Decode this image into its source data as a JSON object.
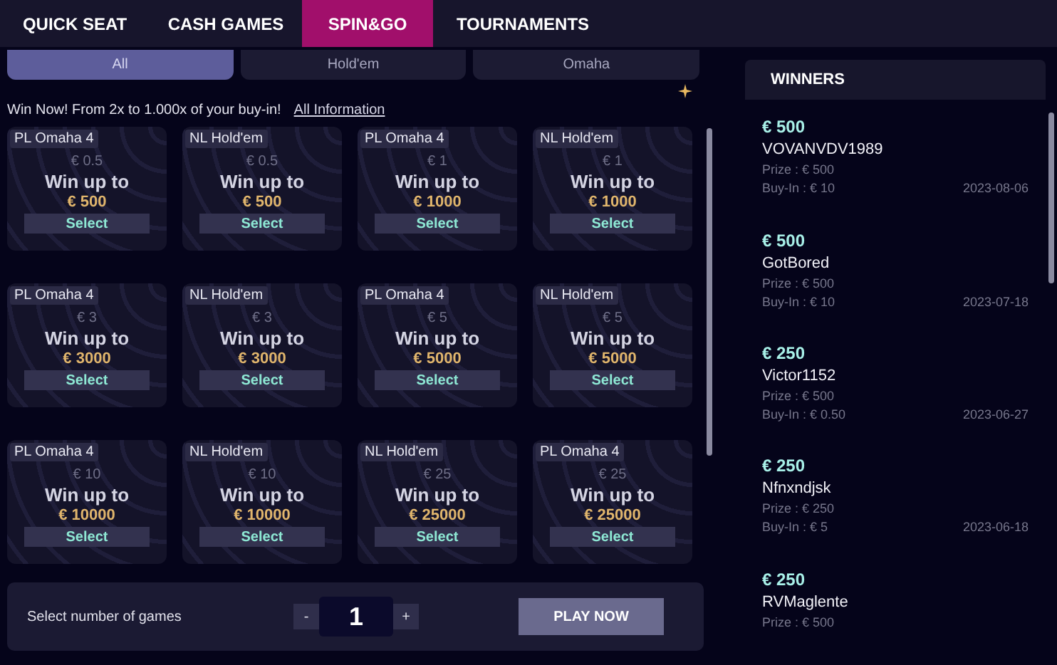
{
  "nav_tabs": [
    {
      "label": "QUICK SEAT",
      "selected": false
    },
    {
      "label": "CASH GAMES",
      "selected": false
    },
    {
      "label": "SPIN&GO",
      "selected": true
    },
    {
      "label": "TOURNAMENTS",
      "selected": false
    }
  ],
  "filters": [
    {
      "label": "All",
      "selected": true
    },
    {
      "label": "Hold'em",
      "selected": false
    },
    {
      "label": "Omaha",
      "selected": false
    }
  ],
  "info": {
    "text": "Win Now! From 2x to 1.000x of your buy-in!",
    "link": "All Information"
  },
  "games": [
    {
      "variant": "PL Omaha 4",
      "buy_in": "€ 0.5",
      "headline": "Win up to",
      "prize": "€ 500",
      "action": "Select"
    },
    {
      "variant": "NL Hold'em",
      "buy_in": "€ 0.5",
      "headline": "Win up to",
      "prize": "€ 500",
      "action": "Select"
    },
    {
      "variant": "PL Omaha 4",
      "buy_in": "€ 1",
      "headline": "Win up to",
      "prize": "€ 1000",
      "action": "Select"
    },
    {
      "variant": "NL Hold'em",
      "buy_in": "€ 1",
      "headline": "Win up to",
      "prize": "€ 1000",
      "action": "Select"
    },
    {
      "variant": "PL Omaha 4",
      "buy_in": "€ 3",
      "headline": "Win up to",
      "prize": "€ 3000",
      "action": "Select"
    },
    {
      "variant": "NL Hold'em",
      "buy_in": "€ 3",
      "headline": "Win up to",
      "prize": "€ 3000",
      "action": "Select"
    },
    {
      "variant": "PL Omaha 4",
      "buy_in": "€ 5",
      "headline": "Win up to",
      "prize": "€ 5000",
      "action": "Select"
    },
    {
      "variant": "NL Hold'em",
      "buy_in": "€ 5",
      "headline": "Win up to",
      "prize": "€ 5000",
      "action": "Select"
    },
    {
      "variant": "PL Omaha 4",
      "buy_in": "€ 10",
      "headline": "Win up to",
      "prize": "€ 10000",
      "action": "Select"
    },
    {
      "variant": "NL Hold'em",
      "buy_in": "€ 10",
      "headline": "Win up to",
      "prize": "€ 10000",
      "action": "Select"
    },
    {
      "variant": "NL Hold'em",
      "buy_in": "€ 25",
      "headline": "Win up to",
      "prize": "€ 25000",
      "action": "Select"
    },
    {
      "variant": "PL Omaha 4",
      "buy_in": "€ 25",
      "headline": "Win up to",
      "prize": "€ 25000",
      "action": "Select"
    }
  ],
  "game_count": {
    "label": "Select number of games",
    "minus": "-",
    "value": "1",
    "plus": "+",
    "play": "PLAY NOW"
  },
  "winners": {
    "title": "WINNERS",
    "items": [
      {
        "amount": "€ 500",
        "name": "VOVANVDV1989",
        "prize": "Prize : € 500",
        "buy_in": "Buy-In : € 10",
        "date": "2023-08-06"
      },
      {
        "amount": "€ 500",
        "name": "GotBored",
        "prize": "Prize : € 500",
        "buy_in": "Buy-In : € 10",
        "date": "2023-07-18"
      },
      {
        "amount": "€ 250",
        "name": "Victor1152",
        "prize": "Prize : € 500",
        "buy_in": "Buy-In : € 0.50",
        "date": "2023-06-27"
      },
      {
        "amount": "€ 250",
        "name": "Nfnxndjsk",
        "prize": "Prize : € 250",
        "buy_in": "Buy-In : € 5",
        "date": "2023-06-18"
      },
      {
        "amount": "€ 250",
        "name": "RVMaglente",
        "prize": "Prize : € 500"
      }
    ]
  }
}
